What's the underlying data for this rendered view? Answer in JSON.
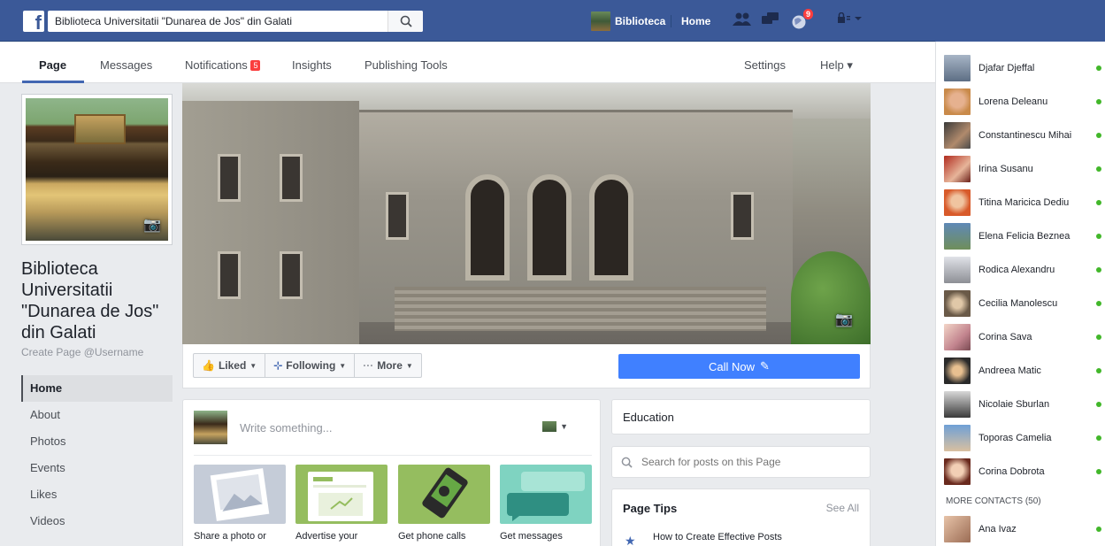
{
  "topbar": {
    "search_value": "Biblioteca Universitatii \"Dunarea de Jos\" din Galati",
    "profile_name": "Biblioteca",
    "home": "Home",
    "notif_count": "9"
  },
  "subnav": {
    "page": "Page",
    "messages": "Messages",
    "notifications": "Notifications",
    "notifications_badge": "5",
    "insights": "Insights",
    "publishing_tools": "Publishing Tools",
    "settings": "Settings",
    "help": "Help ▾"
  },
  "page": {
    "name": "Biblioteca Universitatii \"Dunarea de Jos\" din Galati",
    "username_cta": "Create Page @Username"
  },
  "leftnav": [
    "Home",
    "About",
    "Photos",
    "Events",
    "Likes",
    "Videos"
  ],
  "actions": {
    "liked": "Liked",
    "following": "Following",
    "more": "More",
    "call_now": "Call Now"
  },
  "composer": {
    "placeholder": "Write something...",
    "tiles": [
      "Share a photo or",
      "Advertise your",
      "Get phone calls",
      "Get messages"
    ]
  },
  "right": {
    "education": "Education",
    "search_placeholder": "Search for posts on this Page",
    "page_tips": "Page Tips",
    "see_all": "See All",
    "tip_item": "How to Create Effective Posts"
  },
  "chat": {
    "contacts": [
      "Djafar Djeffal",
      "Lorena Deleanu",
      "Constantinescu Mihai",
      "Irina Susanu",
      "Titina Maricica Dediu",
      "Elena Felicia Beznea",
      "Rodica Alexandru",
      "Cecilia Manolescu",
      "Corina Sava",
      "Andreea Matic",
      "Nicolaie Sburlan",
      "Toporas Camelia",
      "Corina Dobrota"
    ],
    "more_contacts": "MORE CONTACTS (50)",
    "extra_contact": "Ana Ivaz"
  },
  "colors": {
    "brand": "#3b5998",
    "accent": "#4080ff",
    "online": "#42b72a",
    "badge": "#fa3e3e"
  }
}
